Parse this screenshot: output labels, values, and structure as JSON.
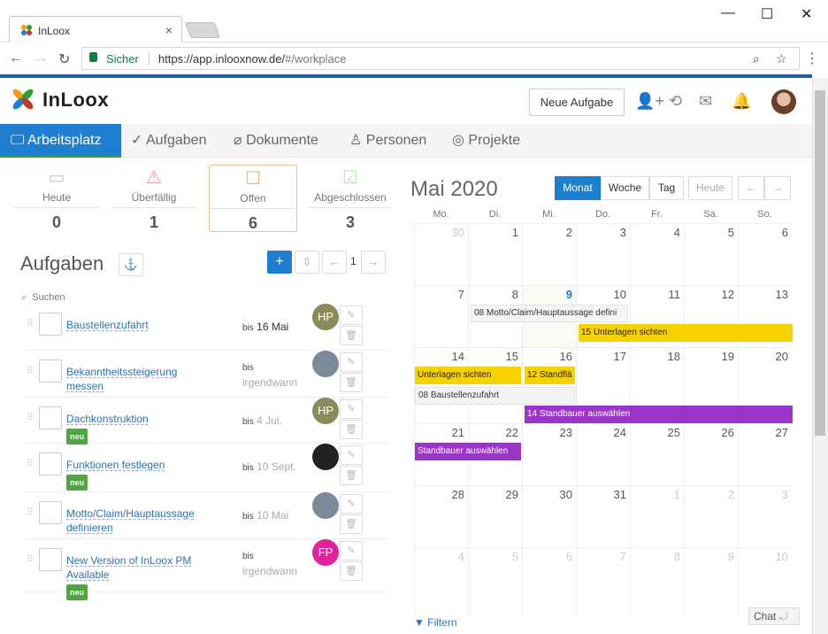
{
  "browser": {
    "tab_title": "InLoox",
    "secure_label": "Sicher",
    "url_host": "https://app.inlooxnow.de/",
    "url_path": "#/workplace"
  },
  "header": {
    "logo_text": "InLoox",
    "new_task_label": "Neue Aufgabe"
  },
  "nav": {
    "items": [
      {
        "label": "Arbeitsplatz"
      },
      {
        "label": "Aufgaben"
      },
      {
        "label": "Dokumente"
      },
      {
        "label": "Personen"
      },
      {
        "label": "Projekte"
      }
    ]
  },
  "stats": [
    {
      "label": "Heute",
      "count": "0"
    },
    {
      "label": "Überfällig",
      "count": "1"
    },
    {
      "label": "Offen",
      "count": "6"
    },
    {
      "label": "Abgeschlossen",
      "count": "3"
    }
  ],
  "tasks_panel": {
    "title": "Aufgaben",
    "page": "1",
    "search_placeholder": "Suchen",
    "tasks": [
      {
        "name": "Baustellenzufahrt",
        "badge": "",
        "bis": "bis",
        "due": "16 Mai",
        "avatar": "HP",
        "avatar_color": "#8b8a5a"
      },
      {
        "name": "Bekanntheitssteigerung messen",
        "badge": "",
        "bis": "bis",
        "due": "irgendwann",
        "avatar": "",
        "avatar_color": "#7a8a99"
      },
      {
        "name": "Dachkonstruktion",
        "badge": "neu",
        "bis": "bis",
        "due": "4 Jul.",
        "avatar": "HP",
        "avatar_color": "#8b8a5a"
      },
      {
        "name": "Funktionen festlegen",
        "badge": "neu",
        "bis": "bis",
        "due": "10 Sept.",
        "avatar": "",
        "avatar_color": "#222222"
      },
      {
        "name": "Motto/Claim/Hauptaussage definieren",
        "badge": "",
        "bis": "bis",
        "due": "10 Mai",
        "avatar": "",
        "avatar_color": "#7a8a99"
      },
      {
        "name": "New Version of InLoox PM Available",
        "badge": "neu",
        "bis": "bis",
        "due": "irgendwann",
        "avatar": "FP",
        "avatar_color": "#e0239a"
      }
    ]
  },
  "calendar": {
    "title": "Mai 2020",
    "views": {
      "month": "Monat",
      "week": "Woche",
      "day": "Tag",
      "today": "Heute"
    },
    "weekdays": [
      "Mo.",
      "Di.",
      "Mi.",
      "Do.",
      "Fr.",
      "Sa.",
      "So."
    ],
    "weeks": [
      [
        "30",
        "1",
        "2",
        "3",
        "4",
        "5",
        "6"
      ],
      [
        "7",
        "8",
        "9",
        "10",
        "11",
        "12",
        "13"
      ],
      [
        "14",
        "15",
        "16",
        "17",
        "18",
        "19",
        "20"
      ],
      [
        "21",
        "22",
        "23",
        "24",
        "25",
        "26",
        "27"
      ],
      [
        "28",
        "29",
        "30",
        "31",
        "1",
        "2",
        "3"
      ],
      [
        "4",
        "5",
        "6",
        "7",
        "8",
        "9",
        "10"
      ]
    ],
    "events": [
      {
        "text": "08 Motto/Claim/Hauptaussage defini",
        "style": "gray"
      },
      {
        "text": "15 Unterlagen sichten",
        "style": "yellow"
      },
      {
        "text": "Unterlagen sichten",
        "style": "yellow"
      },
      {
        "text": "12 Standflä",
        "style": "yellow"
      },
      {
        "text": "08 Baustellenzufahrt",
        "style": "gray"
      },
      {
        "text": "14 Standbauer auswählen",
        "style": "purple"
      },
      {
        "text": "Standbauer auswählen",
        "style": "purple"
      }
    ],
    "filter_label": "Filtern"
  },
  "chat_label": "Chat"
}
